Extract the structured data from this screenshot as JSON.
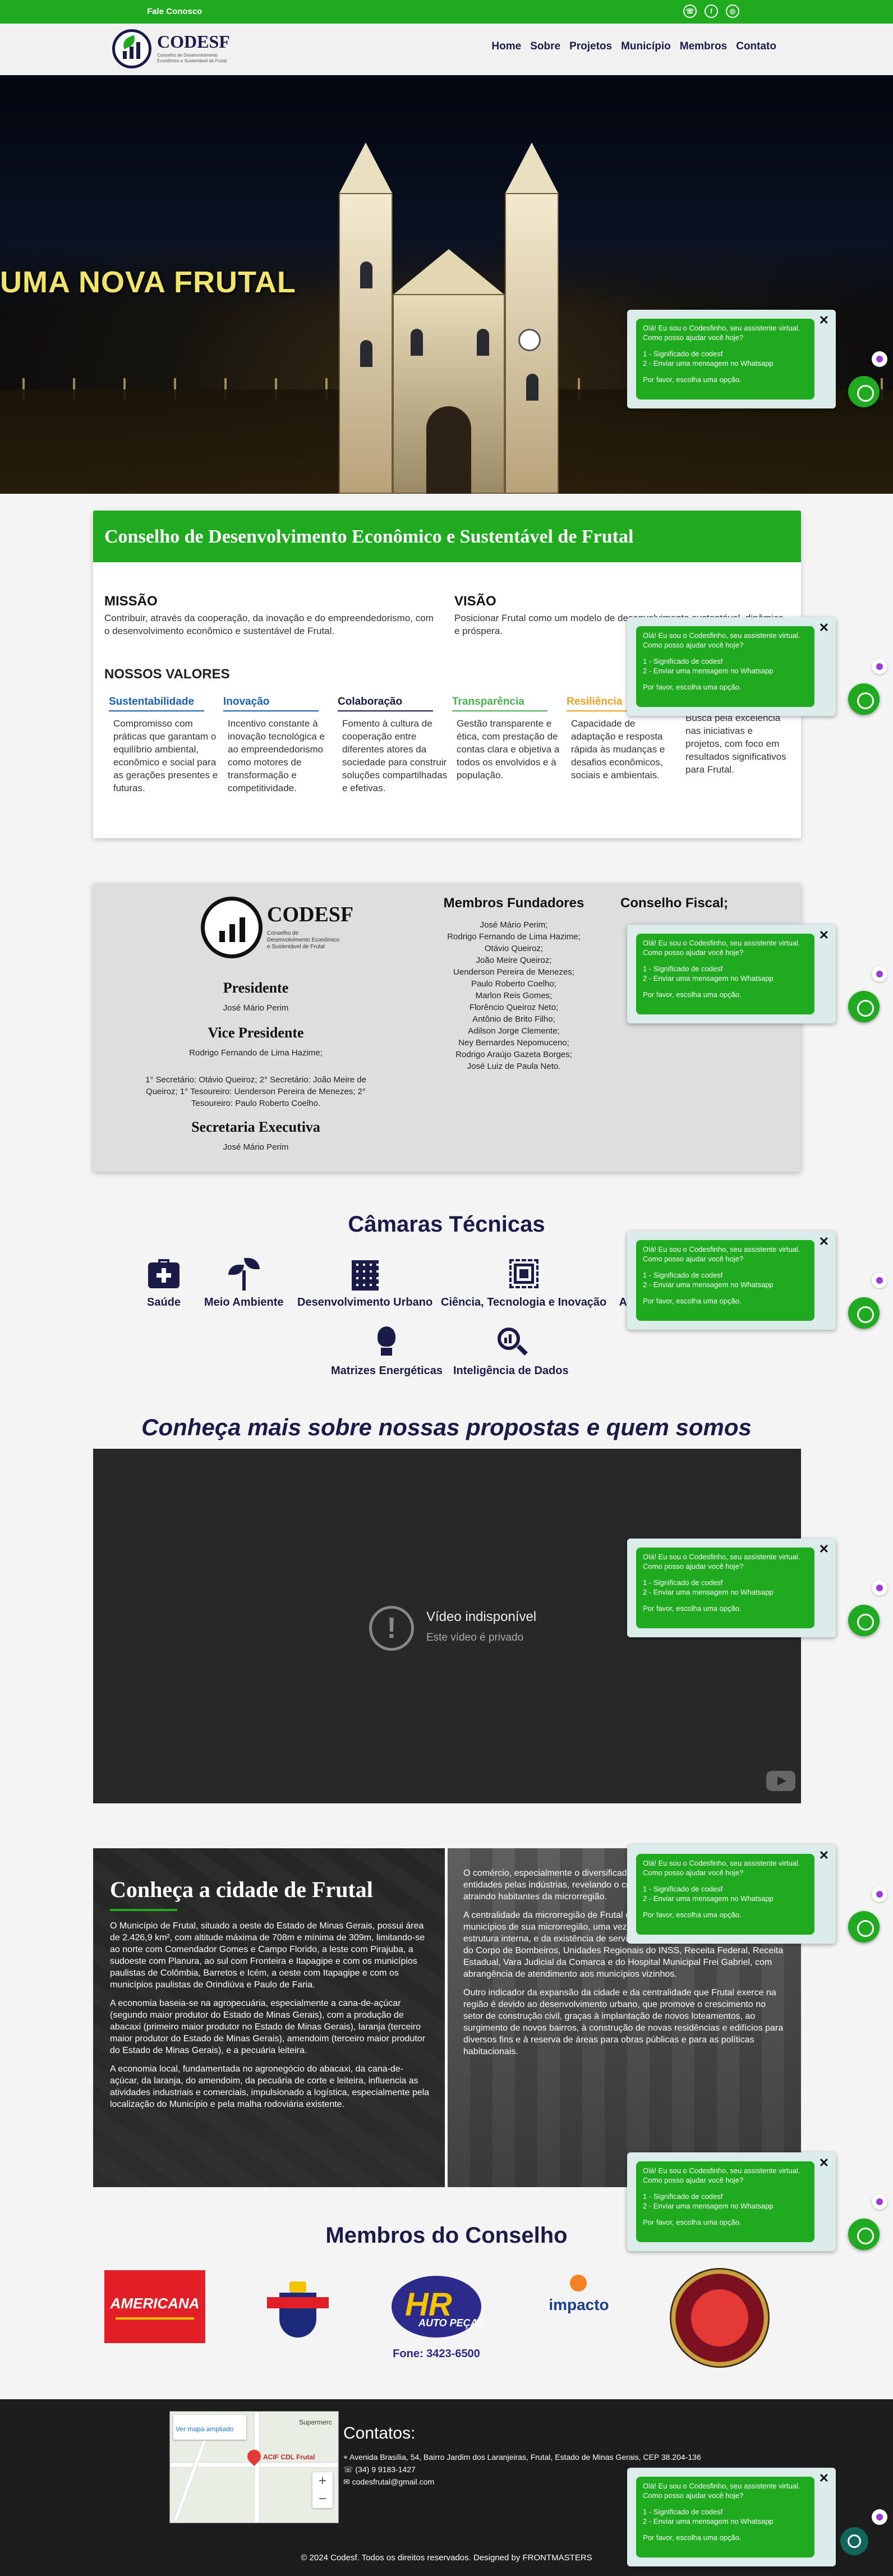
{
  "topbar": {
    "fale": "Fale Conosco",
    "social": [
      "whatsapp-icon",
      "facebook-icon",
      "instagram-icon"
    ]
  },
  "logo": {
    "name": "CODESF",
    "sub": "Conselho de Desenvolvimento Econômico e Sustentável de Frutal"
  },
  "nav": [
    "Home",
    "Sobre",
    "Projetos",
    "Município",
    "Membros",
    "Contato"
  ],
  "hero": {
    "title": "UMA NOVA FRUTAL"
  },
  "about": {
    "title": "Conselho de Desenvolvimento Econômico e Sustentável de Frutal",
    "missao_title": "MISSÃO",
    "missao": "Contribuir, através da cooperação, da inovação e do empreendedorismo, com o desenvolvimento econômico e sustentável de Frutal.",
    "visao_title": "VISÃO",
    "visao": "Posicionar Frutal como um modelo de desenvolvimento sustentável, dinâmica e próspera.",
    "valores_title": "NOSSOS VALORES",
    "valores": [
      {
        "t": "Sustentabilidade",
        "d": "Compromisso com práticas que garantam o equilíbrio ambiental, econômico e social para as gerações presentes e futuras.",
        "c": "#1a5fb4"
      },
      {
        "t": "Inovação",
        "d": "Incentivo constante à inovação tecnológica e ao empreendedorismo como motores de transformação e competitividade.",
        "c": "#1a5fb4"
      },
      {
        "t": "Colaboração",
        "d": "Fomento à cultura de cooperação entre diferentes atores da sociedade para construir soluções compartilhadas e efetivas.",
        "c": "#1b1b4a"
      },
      {
        "t": "Transparência",
        "d": "Gestão transparente e ética, com prestação de contas clara e objetiva a todos os envolvidos e à população.",
        "c": "#4caf50"
      },
      {
        "t": "Resiliência",
        "d": "Capacidade de adaptação e resposta rápida às mudanças e desafios econômicos, sociais e ambientais.",
        "c": "#f0a020"
      },
      {
        "t": "",
        "d": "Busca pela excelência nas iniciativas e projetos, com foco em resultados significativos para Frutal.",
        "c": "#1b1b4a"
      }
    ]
  },
  "council": {
    "presidente_t": "Presidente",
    "presidente": "José Mário Perim",
    "vice_t": "Vice Presidente",
    "vice": "Rodrigo Fernando de Lima Hazime;",
    "sec_lines": [
      "1° Secretário: Otávio Queiroz; 2° Secretário: João Meire de",
      "Queiroz; 1° Tesoureiro: Uenderson Pereira de Menezes; 2°",
      "Tesoureiro: Paulo Roberto Coelho."
    ],
    "exec_t": "Secretaria Executiva",
    "exec": "José Mário Perim",
    "fund_t": "Membros Fundadores",
    "fundadores": [
      "José Mário Perim;",
      "Rodrigo Fernando de Lima Hazime;",
      "Otávio Queiroz;",
      "João Meire Queiroz;",
      "Uenderson Pereira de Menezes;",
      "Paulo Roberto Coelho;",
      "Marlon Reis Gomes;",
      "Florêncio Queiroz Neto;",
      "Antônio de Brito Filho;",
      "Adilson Jorge Clemente;",
      "Ney Bernardes Nepomuceno;",
      "Rodrigo Araújo Gazeta Borges;",
      "José Luiz de Paula Neto."
    ],
    "fiscal_t": "Conselho Fiscal;"
  },
  "camaras": {
    "title": "Câmaras Técnicas",
    "items": [
      {
        "label": "Saúde",
        "icon": "medical-kit-icon"
      },
      {
        "label": "Meio Ambiente",
        "icon": "sprout-icon"
      },
      {
        "label": "Desenvolvimento Urbano",
        "icon": "buildings-icon"
      },
      {
        "label": "Ciência, Tecnologia e Inovação",
        "icon": "chip-icon"
      },
      {
        "label": "Atr",
        "icon": "briefcase-icon"
      },
      {
        "label": "Matrizes Energéticas",
        "icon": "lightbulb-icon"
      },
      {
        "label": "Inteligência de Dados",
        "icon": "data-search-icon"
      }
    ]
  },
  "video": {
    "title": "Conheça mais sobre nossas propostas e quem somos",
    "t1": "Vídeo indisponível",
    "t2": "Este vídeo é privado"
  },
  "cidade": {
    "title": "Conheça a cidade de Frutal",
    "left": [
      "O Município de Frutal, situado a oeste do Estado de Minas Gerais, possui área de 2.426,9 km², com altitude máxima de 708m e mínima de 309m, limitando-se ao norte com Comendador Gomes e Campo Florido, a leste com Pirajuba, a sudoeste com Planura, ao sul com Fronteira e Itapagipe e com os municípios paulistas de Colômbia, Barretos e Icém, a oeste com Itapagipe e com os municípios paulistas de Orindiúva e Paulo de Faria.",
      "A economia baseia-se na agropecuária, especialmente a cana-de-açúcar (segundo maior produtor do Estado de Minas Gerais), com a produção de abacaxi (primeiro maior produtor no Estado de Minas Gerais), laranja (terceiro maior produtor do Estado de Minas Gerais), amendoim (terceiro maior produtor do Estado de Minas Gerais), e a pecuária leiteira.",
      "A economia local, fundamentada no agronegócio do abacaxi, da cana-de-açúcar, da laranja, do amendoim, da pecuária de corte e leiteira, influencia as atividades industriais e comerciais, impulsionado a logística, especialmente pela localização do Município e pela malha rodoviária existente."
    ],
    "right": [
      "O comércio, especialmente o diversificado, e de serviços (que inclui as entidades pelas indústrias, revelando o crescimento socioeconômico com atraindo habitantes da microrregião.",
      "A centralidade da microrregião de Frutal exerce um papel importante de municípios de sua microrregião, uma vez que apresenta boa estrutura de boa estrutura interna, e da existência de serviços especializados, como a Unidade do Corpo de Bombeiros, Unidades Regionais do INSS, Receita Federal, Receita Estadual, Vara Judicial da Comarca e do Hospital Municipal Frei Gabriel, com abrangência de atendimento aos municípios vizinhos.",
      "Outro indicador da expansão da cidade e da centralidade que Frutal exerce na região é devido ao desenvolvimento urbano, que promove o crescimento no setor de construção civil, graças à implantação de novos loteamentos, ao surgimento de novos bairros, à construção de novas residências e edifícios para diversos fins e à reserva de áreas para obras públicas e para as políticas habitacionais."
    ]
  },
  "membros": {
    "title": "Membros do Conselho",
    "logos": [
      "AMERICANA",
      "Fone: 3423-6500",
      "impacto",
      "HR AUTO PEÇAS"
    ]
  },
  "footer": {
    "map": {
      "label1": "ACIF CDL Frutal",
      "label2": "Ver mapa ampliado",
      "label3": "ACIF CDL Frutal",
      "label4": "Supermerc"
    },
    "contatos_t": "Contatos:",
    "address": "Avenida Brasília, 54, Bairro Jardim dos Laranjeiras, Frutal, Estado de Minas Gerais, CEP 38.204-136",
    "phone": "(34) 9 9183-1427",
    "email": "codesfrutal@gmail.com",
    "copy": "© 2024 Codesf. Todos os direitos reservados. Designed by FRONTMASTERS"
  },
  "chat": {
    "greeting": "Olá! Eu sou o Codesfinho, seu assistente virtual. Como posso ajudar você hoje?",
    "opt1": "1 - Significado de codesf",
    "opt2": "2 - Enviar uma mensagem no Whatsapp",
    "prompt": "Por favor, escolha uma opção."
  },
  "colors": {
    "green": "#1faa1f",
    "navy": "#1b1b4a"
  }
}
